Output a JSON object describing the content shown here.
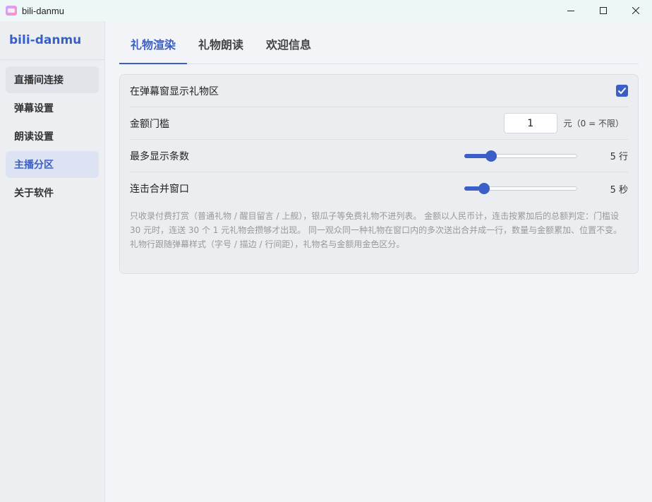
{
  "window": {
    "title": "bili-danmu"
  },
  "sidebar": {
    "brand": "bili-danmu",
    "items": [
      {
        "label": "直播间连接",
        "state": "hover"
      },
      {
        "label": "弹幕设置",
        "state": "normal"
      },
      {
        "label": "朗读设置",
        "state": "normal"
      },
      {
        "label": "主播分区",
        "state": "active"
      },
      {
        "label": "关于软件",
        "state": "normal"
      }
    ]
  },
  "tabs": [
    {
      "label": "礼物渲染",
      "active": true
    },
    {
      "label": "礼物朗读",
      "active": false
    },
    {
      "label": "欢迎信息",
      "active": false
    }
  ],
  "settings": {
    "show_gift_area": {
      "label": "在弹幕窗显示礼物区",
      "checked": true
    },
    "amount_threshold": {
      "label": "金额门槛",
      "value": "1",
      "unit": "元（0 = 不限）"
    },
    "max_rows": {
      "label": "最多显示条数",
      "value": 5,
      "min": 1,
      "max": 20,
      "value_text": "5 行"
    },
    "combo_window": {
      "label": "连击合并窗口",
      "value": 5,
      "min": 1,
      "max": 30,
      "value_text": "5 秒"
    },
    "note": "只收录付费打赏（普通礼物 / 醒目留言 / 上舰），银瓜子等免费礼物不进列表。 金额以人民币计，连击按累加后的总额判定：门槛设 30 元时，连送 30 个 1 元礼物会攒够才出现。 同一观众同一种礼物在窗口内的多次送出合并成一行，数量与金额累加、位置不变。 礼物行跟随弹幕样式（字号 / 描边 / 行间距），礼物名与金额用金色区分。"
  },
  "colors": {
    "accent": "#3a5fc7",
    "sidebar_bg": "#eceef2",
    "content_bg": "#f3f4f7"
  }
}
